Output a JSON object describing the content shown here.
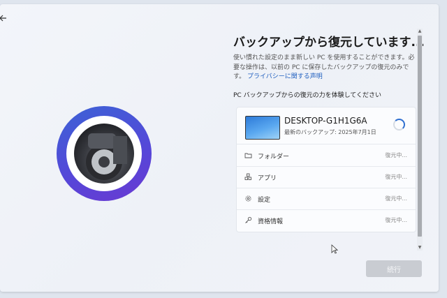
{
  "title": "バックアップから復元しています...",
  "description": {
    "text": "使い慣れた設定のまま新しい PC を使用することができます。必要な操作は、以前の PC に保存したバックアップの復元のみです。",
    "link": "プライバシーに関する声明"
  },
  "subheading": "PC バックアップからの復元の力を体験してください",
  "device": {
    "name": "DESKTOP-G1H1G6A",
    "last_backup": "最新のバックアップ: 2025年7月1日"
  },
  "items": [
    {
      "icon": "folder-icon",
      "label": "フォルダー",
      "status": "復元中..."
    },
    {
      "icon": "apps-icon",
      "label": "アプリ",
      "status": "復元中..."
    },
    {
      "icon": "gear-icon",
      "label": "設定",
      "status": "復元中..."
    },
    {
      "icon": "key-icon",
      "label": "資格情報",
      "status": "復元中..."
    }
  ],
  "buttons": {
    "continue": "続行"
  },
  "colors": {
    "accent": "#2f6fd0",
    "ring": "#4a55d8",
    "disabled_button": "#c9ccd2"
  }
}
